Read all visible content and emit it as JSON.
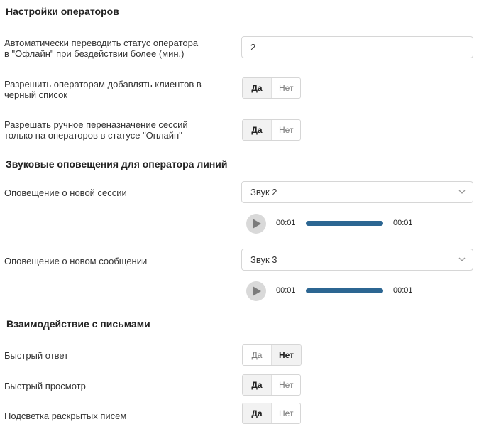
{
  "operators": {
    "title": "Настройки операторов",
    "auto_offline": {
      "label_line1": "Автоматически переводить статус оператора",
      "label_line2": "в \"Офлайн\" при бездействии более (мин.)",
      "value": "2"
    },
    "blacklist": {
      "label_line1": "Разрешить операторам добавлять клиентов в",
      "label_line2": "черный список",
      "yes": "Да",
      "no": "Нет",
      "selected": "yes"
    },
    "reassign": {
      "label_line1": "Разрешать ручное переназначение сессий",
      "label_line2": "только на операторов в статусе \"Онлайн\"",
      "yes": "Да",
      "no": "Нет",
      "selected": "yes"
    }
  },
  "sounds": {
    "title": "Звуковые оповещения для оператора линий",
    "new_session": {
      "label": "Оповещение о новой сессии",
      "value": "Звук 2",
      "player": {
        "current": "00:01",
        "duration": "00:01",
        "progress": 1.0
      }
    },
    "new_message": {
      "label": "Оповещение о новом сообщении",
      "value": "Звук 3",
      "player": {
        "current": "00:01",
        "duration": "00:01",
        "progress": 1.0
      }
    }
  },
  "emails": {
    "title": "Взаимодействие с письмами",
    "quick_reply": {
      "label": "Быстрый ответ",
      "yes": "Да",
      "no": "Нет",
      "selected": "no"
    },
    "quick_view": {
      "label": "Быстрый просмотр",
      "yes": "Да",
      "no": "Нет",
      "selected": "yes"
    },
    "highlight": {
      "label": "Подсветка раскрытых писем",
      "yes": "Да",
      "no": "Нет",
      "selected": "yes"
    }
  },
  "colors": {
    "accent": "#2c6692",
    "active_toggle_bg": "#f2f2f2",
    "border": "#d6d6d6"
  },
  "icons": {
    "select_chevron": "chevron-down-icon",
    "play": "play-icon"
  }
}
